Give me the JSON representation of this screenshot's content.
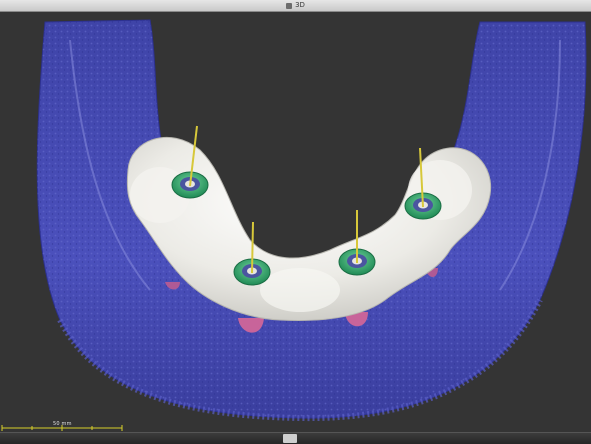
{
  "window": {
    "title": "3D",
    "icon": "3d-view-icon"
  },
  "viewport": {
    "background": "#343434",
    "scale_bar": {
      "label": "50 mm",
      "color": "#d8cf2a"
    },
    "colors": {
      "bone": "#4a4fb8",
      "guide": "#eeeeea",
      "sleeve": "#2ea36a",
      "pin": "#d7c83a",
      "implant": "#c8649a"
    },
    "sleeves": 4,
    "pins": 4
  },
  "statusbar": {
    "splitter": "splitter-handle"
  }
}
